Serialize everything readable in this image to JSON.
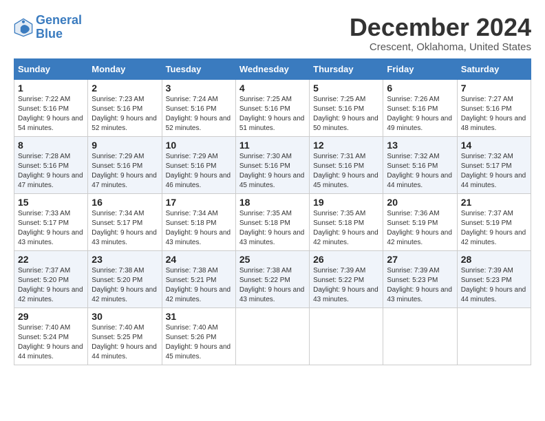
{
  "header": {
    "logo_line1": "General",
    "logo_line2": "Blue",
    "month": "December 2024",
    "location": "Crescent, Oklahoma, United States"
  },
  "weekdays": [
    "Sunday",
    "Monday",
    "Tuesday",
    "Wednesday",
    "Thursday",
    "Friday",
    "Saturday"
  ],
  "weeks": [
    [
      {
        "day": "1",
        "sunrise": "7:22 AM",
        "sunset": "5:16 PM",
        "daylight": "9 hours and 54 minutes."
      },
      {
        "day": "2",
        "sunrise": "7:23 AM",
        "sunset": "5:16 PM",
        "daylight": "9 hours and 52 minutes."
      },
      {
        "day": "3",
        "sunrise": "7:24 AM",
        "sunset": "5:16 PM",
        "daylight": "9 hours and 52 minutes."
      },
      {
        "day": "4",
        "sunrise": "7:25 AM",
        "sunset": "5:16 PM",
        "daylight": "9 hours and 51 minutes."
      },
      {
        "day": "5",
        "sunrise": "7:25 AM",
        "sunset": "5:16 PM",
        "daylight": "9 hours and 50 minutes."
      },
      {
        "day": "6",
        "sunrise": "7:26 AM",
        "sunset": "5:16 PM",
        "daylight": "9 hours and 49 minutes."
      },
      {
        "day": "7",
        "sunrise": "7:27 AM",
        "sunset": "5:16 PM",
        "daylight": "9 hours and 48 minutes."
      }
    ],
    [
      {
        "day": "8",
        "sunrise": "7:28 AM",
        "sunset": "5:16 PM",
        "daylight": "9 hours and 47 minutes."
      },
      {
        "day": "9",
        "sunrise": "7:29 AM",
        "sunset": "5:16 PM",
        "daylight": "9 hours and 47 minutes."
      },
      {
        "day": "10",
        "sunrise": "7:29 AM",
        "sunset": "5:16 PM",
        "daylight": "9 hours and 46 minutes."
      },
      {
        "day": "11",
        "sunrise": "7:30 AM",
        "sunset": "5:16 PM",
        "daylight": "9 hours and 45 minutes."
      },
      {
        "day": "12",
        "sunrise": "7:31 AM",
        "sunset": "5:16 PM",
        "daylight": "9 hours and 45 minutes."
      },
      {
        "day": "13",
        "sunrise": "7:32 AM",
        "sunset": "5:16 PM",
        "daylight": "9 hours and 44 minutes."
      },
      {
        "day": "14",
        "sunrise": "7:32 AM",
        "sunset": "5:17 PM",
        "daylight": "9 hours and 44 minutes."
      }
    ],
    [
      {
        "day": "15",
        "sunrise": "7:33 AM",
        "sunset": "5:17 PM",
        "daylight": "9 hours and 43 minutes."
      },
      {
        "day": "16",
        "sunrise": "7:34 AM",
        "sunset": "5:17 PM",
        "daylight": "9 hours and 43 minutes."
      },
      {
        "day": "17",
        "sunrise": "7:34 AM",
        "sunset": "5:18 PM",
        "daylight": "9 hours and 43 minutes."
      },
      {
        "day": "18",
        "sunrise": "7:35 AM",
        "sunset": "5:18 PM",
        "daylight": "9 hours and 43 minutes."
      },
      {
        "day": "19",
        "sunrise": "7:35 AM",
        "sunset": "5:18 PM",
        "daylight": "9 hours and 42 minutes."
      },
      {
        "day": "20",
        "sunrise": "7:36 AM",
        "sunset": "5:19 PM",
        "daylight": "9 hours and 42 minutes."
      },
      {
        "day": "21",
        "sunrise": "7:37 AM",
        "sunset": "5:19 PM",
        "daylight": "9 hours and 42 minutes."
      }
    ],
    [
      {
        "day": "22",
        "sunrise": "7:37 AM",
        "sunset": "5:20 PM",
        "daylight": "9 hours and 42 minutes."
      },
      {
        "day": "23",
        "sunrise": "7:38 AM",
        "sunset": "5:20 PM",
        "daylight": "9 hours and 42 minutes."
      },
      {
        "day": "24",
        "sunrise": "7:38 AM",
        "sunset": "5:21 PM",
        "daylight": "9 hours and 42 minutes."
      },
      {
        "day": "25",
        "sunrise": "7:38 AM",
        "sunset": "5:22 PM",
        "daylight": "9 hours and 43 minutes."
      },
      {
        "day": "26",
        "sunrise": "7:39 AM",
        "sunset": "5:22 PM",
        "daylight": "9 hours and 43 minutes."
      },
      {
        "day": "27",
        "sunrise": "7:39 AM",
        "sunset": "5:23 PM",
        "daylight": "9 hours and 43 minutes."
      },
      {
        "day": "28",
        "sunrise": "7:39 AM",
        "sunset": "5:23 PM",
        "daylight": "9 hours and 44 minutes."
      }
    ],
    [
      {
        "day": "29",
        "sunrise": "7:40 AM",
        "sunset": "5:24 PM",
        "daylight": "9 hours and 44 minutes."
      },
      {
        "day": "30",
        "sunrise": "7:40 AM",
        "sunset": "5:25 PM",
        "daylight": "9 hours and 44 minutes."
      },
      {
        "day": "31",
        "sunrise": "7:40 AM",
        "sunset": "5:26 PM",
        "daylight": "9 hours and 45 minutes."
      },
      null,
      null,
      null,
      null
    ]
  ]
}
